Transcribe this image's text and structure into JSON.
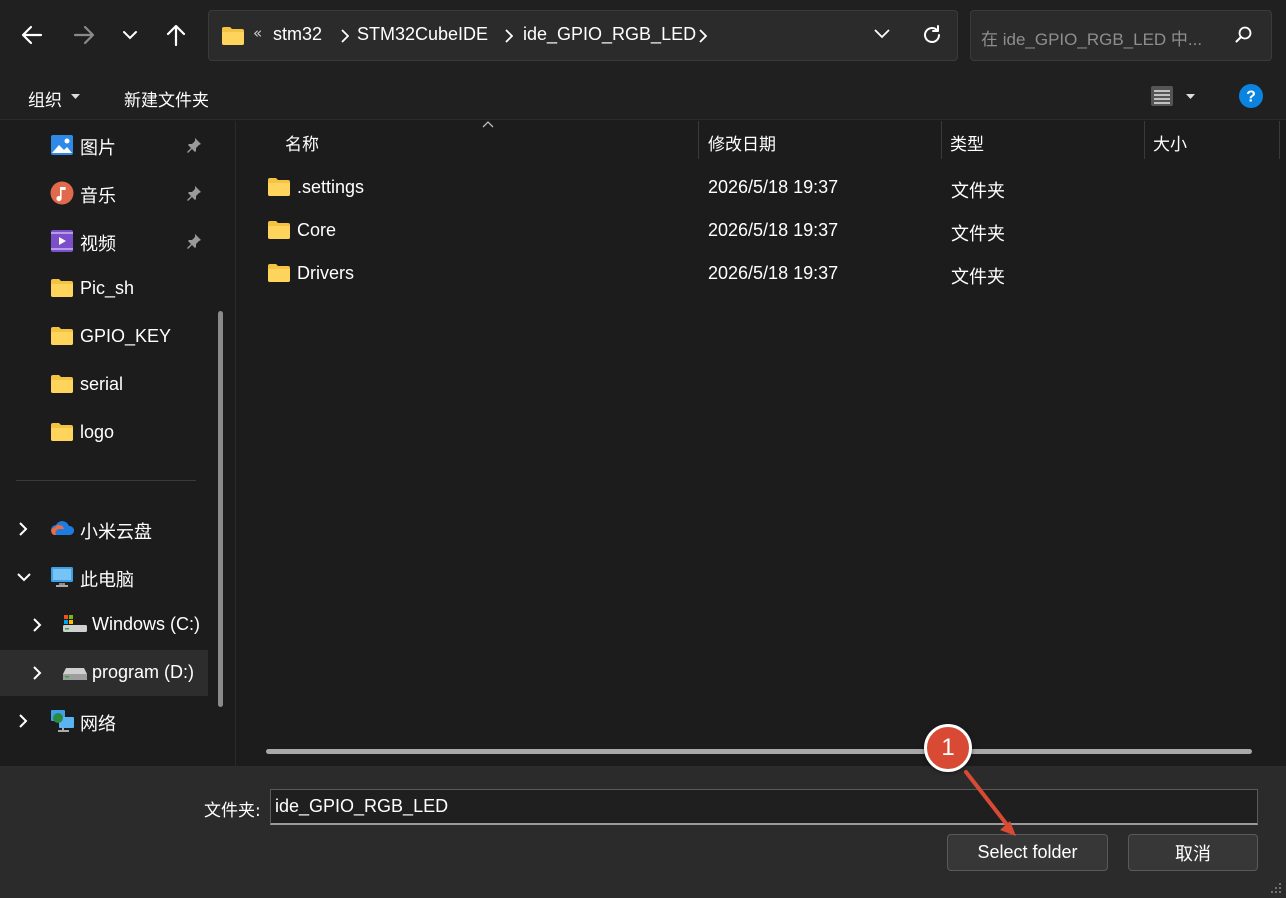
{
  "address": {
    "overflow": "«",
    "crumbs": [
      "stm32",
      "STM32CubeIDE",
      "ide_GPIO_RGB_LED"
    ]
  },
  "search": {
    "placeholder": "在 ide_GPIO_RGB_LED 中..."
  },
  "toolbar": {
    "organize": "组织",
    "new_folder": "新建文件夹"
  },
  "sidebar": {
    "quick": [
      {
        "label": "图片",
        "icon": "pictures-icon"
      },
      {
        "label": "音乐",
        "icon": "music-icon"
      },
      {
        "label": "视频",
        "icon": "videos-icon"
      },
      {
        "label": "Pic_sh",
        "icon": "folder-icon"
      },
      {
        "label": "GPIO_KEY",
        "icon": "folder-icon"
      },
      {
        "label": "serial",
        "icon": "folder-icon"
      },
      {
        "label": "logo",
        "icon": "folder-icon"
      }
    ],
    "tree": [
      {
        "label": "小米云盘",
        "icon": "cloud-icon"
      },
      {
        "label": "此电脑",
        "icon": "computer-icon"
      },
      {
        "label": "Windows (C:)",
        "icon": "drive-c-icon"
      },
      {
        "label": "program (D:)",
        "icon": "drive-d-icon"
      },
      {
        "label": "网络",
        "icon": "network-icon"
      }
    ]
  },
  "columns": {
    "name": "名称",
    "date": "修改日期",
    "type": "类型",
    "size": "大小"
  },
  "files": [
    {
      "name": ".settings",
      "date": "2026/5/18 19:37",
      "type": "文件夹"
    },
    {
      "name": "Core",
      "date": "2026/5/18 19:37",
      "type": "文件夹"
    },
    {
      "name": "Drivers",
      "date": "2026/5/18 19:37",
      "type": "文件夹"
    }
  ],
  "footer": {
    "folder_label": "文件夹:",
    "folder_value": "ide_GPIO_RGB_LED",
    "select_button": "Select folder",
    "cancel_button": "取消"
  },
  "annotation": {
    "step": "1"
  },
  "colors": {
    "accent": "#0078d4",
    "folder": "#f5c342",
    "annotation": "#d94a35"
  }
}
